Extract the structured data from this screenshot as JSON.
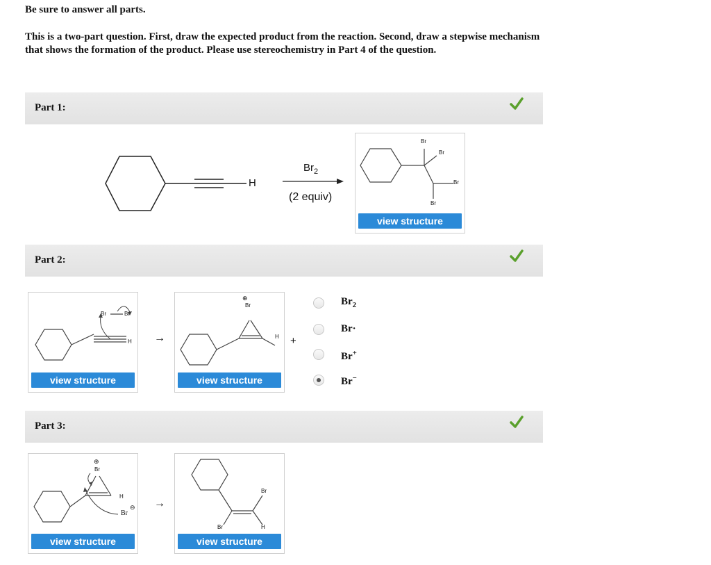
{
  "intro": {
    "line1": "Be sure to answer all parts.",
    "line2": "This is a two-part question. First, draw the expected product from the reaction. Second, draw a stepwise mechanism that shows the formation of the product. Please use stereochemistry in Part 4 of the question."
  },
  "parts": [
    {
      "label": "Part 1:",
      "status": "correct"
    },
    {
      "label": "Part 2:",
      "status": "correct"
    },
    {
      "label": "Part 3:",
      "status": "correct"
    }
  ],
  "colors": {
    "check": "#5aa02c",
    "button": "#2b8ad8"
  },
  "part1": {
    "reactant_h": "H",
    "reagent": "Br",
    "reagent_sub": "2",
    "conditions": "(2 equiv)",
    "product_atoms": {
      "br1": "Br",
      "br2": "Br",
      "br3": "Br",
      "br4": "Br"
    },
    "view_button": "view structure"
  },
  "part2": {
    "box1": {
      "atom_br_a": "Br",
      "atom_br_b": "Br",
      "atom_h": "H",
      "view_button": "view structure"
    },
    "box2": {
      "atom_br": "Br",
      "charge": "⊕",
      "atom_h": "H",
      "view_button": "view structure"
    },
    "step_arrow": "→",
    "plus": "+",
    "options": [
      {
        "main": "Br",
        "sub": "2",
        "sup": "",
        "selected": false
      },
      {
        "main": "Br·",
        "sub": "",
        "sup": "",
        "selected": false
      },
      {
        "main": "Br",
        "sub": "",
        "sup": "+",
        "selected": false
      },
      {
        "main": "Br",
        "sub": "",
        "sup": "−",
        "selected": true
      }
    ]
  },
  "part3": {
    "box1": {
      "atom_br_top": "Br",
      "charge_top": "⊕",
      "atom_h": "H",
      "atom_br_bottom": "Br",
      "charge_bottom": "⊖",
      "view_button": "view structure"
    },
    "step_arrow": "→",
    "box2": {
      "atom_br_right": "Br",
      "atom_br_left": "Br",
      "atom_h": "H",
      "view_button": "view structure"
    }
  }
}
